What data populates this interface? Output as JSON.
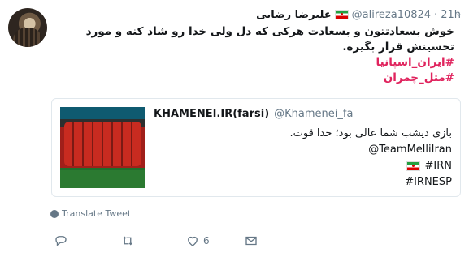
{
  "tweet": {
    "author_name": "علیرضا رضایی",
    "handle": "@alireza10824",
    "dot": "·",
    "time": "21h",
    "text": "خوش بسعادتتون و بسعادت هرکی که دل ولی خدا رو شاد کنه و مورد تحسینش قرار بگیره.",
    "hashtags": [
      "#ایران_اسپانیا",
      "#مثل_چمران"
    ]
  },
  "quoted": {
    "name": "KHAMENEI.IR(farsi)",
    "handle": "@Khamenei_fa",
    "line1": "بازی دیشب شما عالی بود؛ خدا قوت.",
    "line2": "@TeamMelliIran",
    "line3": "#IRN",
    "line4": "#IRNESP"
  },
  "translate_label": "Translate Tweet",
  "actions": {
    "like_count": "6"
  },
  "colors": {
    "hashtag": "#e0245e",
    "muted": "#657786",
    "border": "#e1e8ed"
  },
  "icons": [
    "reply-icon",
    "retweet-icon",
    "heart-icon",
    "direct-message-icon",
    "globe-icon",
    "caret-down-icon",
    "iran-flag-icon"
  ]
}
